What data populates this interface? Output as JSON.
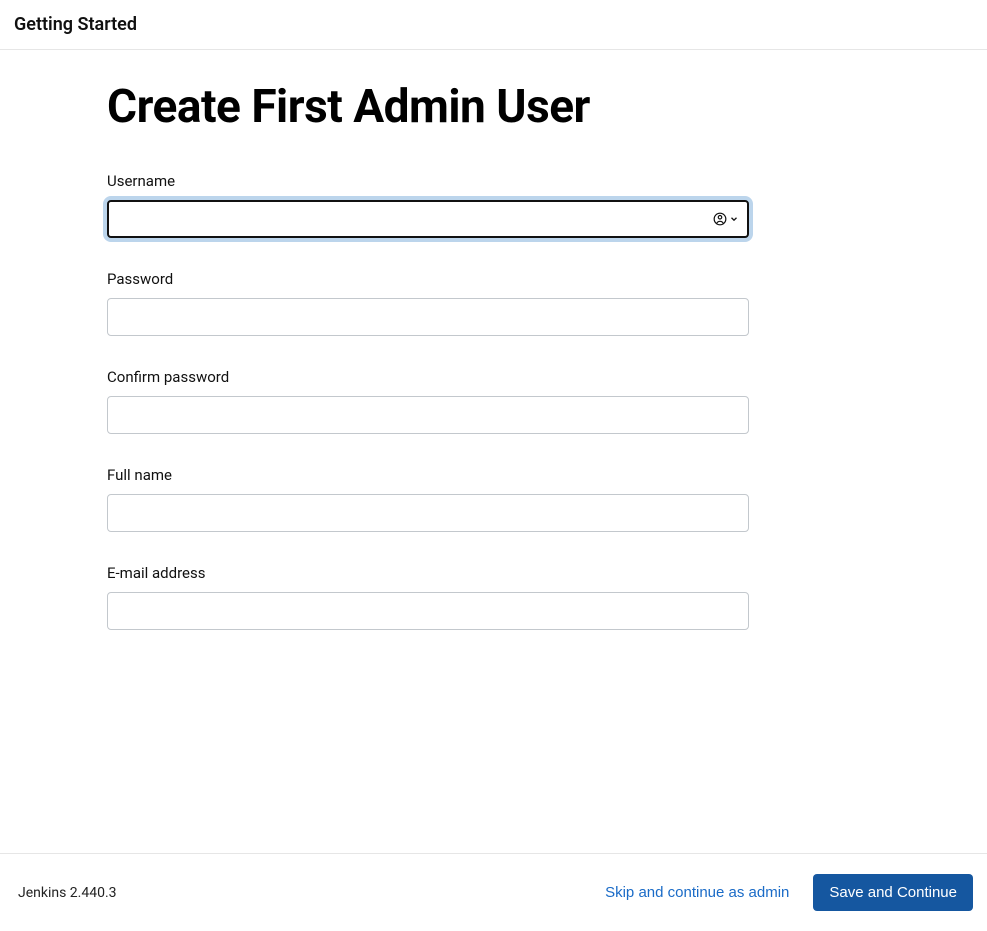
{
  "header": {
    "title": "Getting Started"
  },
  "page": {
    "title": "Create First Admin User"
  },
  "form": {
    "username": {
      "label": "Username",
      "value": ""
    },
    "password": {
      "label": "Password",
      "value": ""
    },
    "confirm_password": {
      "label": "Confirm password",
      "value": ""
    },
    "full_name": {
      "label": "Full name",
      "value": ""
    },
    "email": {
      "label": "E-mail address",
      "value": ""
    }
  },
  "footer": {
    "version": "Jenkins 2.440.3",
    "skip_label": "Skip and continue as admin",
    "save_label": "Save and Continue"
  }
}
